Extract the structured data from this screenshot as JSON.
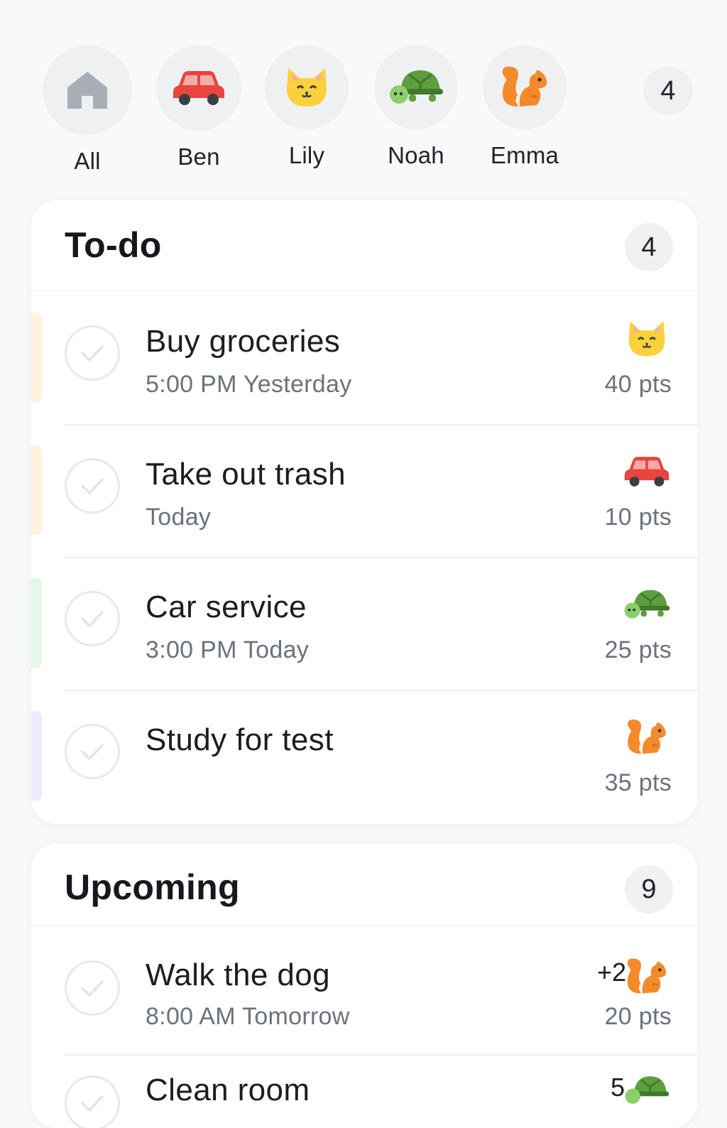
{
  "filters": {
    "items": [
      {
        "label": "All",
        "icon": "home-icon"
      },
      {
        "label": "Ben",
        "icon": "car-icon"
      },
      {
        "label": "Lily",
        "icon": "cat-icon"
      },
      {
        "label": "Noah",
        "icon": "turtle-icon"
      },
      {
        "label": "Emma",
        "icon": "squirrel-icon"
      }
    ],
    "count": "4"
  },
  "todo": {
    "title": "To-do",
    "count": "4",
    "tasks": [
      {
        "title": "Buy groceries",
        "time": "5:00 PM Yesterday",
        "points": "40 pts",
        "assignee_icon": "cat-icon",
        "accent": "#fff3df"
      },
      {
        "title": "Take out trash",
        "time": "Today",
        "points": "10 pts",
        "assignee_icon": "car-icon",
        "accent": "#fff3df"
      },
      {
        "title": "Car service",
        "time": "3:00 PM Today",
        "points": "25 pts",
        "assignee_icon": "turtle-icon",
        "accent": "#e4f7e9"
      },
      {
        "title": "Study for test",
        "time": "",
        "points": "35 pts",
        "assignee_icon": "squirrel-icon",
        "accent": "#efeafd"
      }
    ]
  },
  "upcoming": {
    "title": "Upcoming",
    "count": "9",
    "tasks": [
      {
        "title": "Walk the dog",
        "time": "8:00 AM Tomorrow",
        "points": "20 pts",
        "assignee_icon": "squirrel-icon",
        "extra": "+2"
      },
      {
        "title": "Clean room",
        "time": "",
        "points": "",
        "assignee_icon": "turtle-icon",
        "extra": "5"
      }
    ]
  },
  "colors": {
    "background": "#f8f9fa",
    "card": "#ffffff",
    "chip": "#eef0f2",
    "muted_text": "#6a727c",
    "car_red": "#e8453c",
    "cat_yellow": "#fbd13b",
    "turtle_green": "#5f9e3f",
    "squirrel_orange": "#f58a2a",
    "home_gray": "#a8adb6"
  }
}
